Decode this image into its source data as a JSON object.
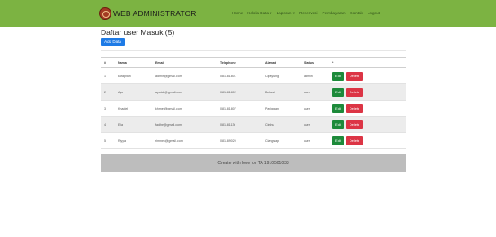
{
  "navbar": {
    "brand": "WEB ADMINISTRATOR",
    "links": [
      "Home",
      "Kelola Data ▾",
      "Laporan ▾",
      "Reservasi",
      "Pembayaran",
      "Kontak",
      "Logout"
    ]
  },
  "page": {
    "title": "Daftar user Masuk (5)",
    "add_button": "Add Data"
  },
  "table": {
    "headers": [
      "#",
      "Nama",
      "Email",
      "Telephone",
      "Alamat",
      "Status",
      "*"
    ],
    "rows": [
      {
        "no": "1",
        "name": "karapitan",
        "email": "admin@gmail.com",
        "phone": "081181801",
        "address": "Cipayung",
        "status": "admin"
      },
      {
        "no": "2",
        "name": "Ayu",
        "email": "ayuick@gmail.com",
        "phone": "081181802",
        "address": "Bekasi",
        "status": "user"
      },
      {
        "no": "3",
        "name": "Khadek",
        "email": "khmet@gmail.com",
        "phone": "081181807",
        "address": "Pasiggan",
        "status": "user"
      },
      {
        "no": "4",
        "name": "Ella",
        "email": "fadhe@gmail.com",
        "phone": "081181130",
        "address": "Cimhu",
        "status": "user"
      },
      {
        "no": "5",
        "name": "Riyya",
        "email": "rimnek@gmail.com",
        "phone": "081189020",
        "address": "Ciangsap",
        "status": "user"
      }
    ],
    "edit_label": "Edit",
    "delete_label": "Delete"
  },
  "footer": {
    "text": "Create with love for TA 1910501033"
  },
  "colors": {
    "navbar": "#7cb342",
    "primary": "#1e7be6",
    "edit": "#1d8a3a",
    "delete": "#dc3545",
    "footer": "#bdbdbd"
  }
}
